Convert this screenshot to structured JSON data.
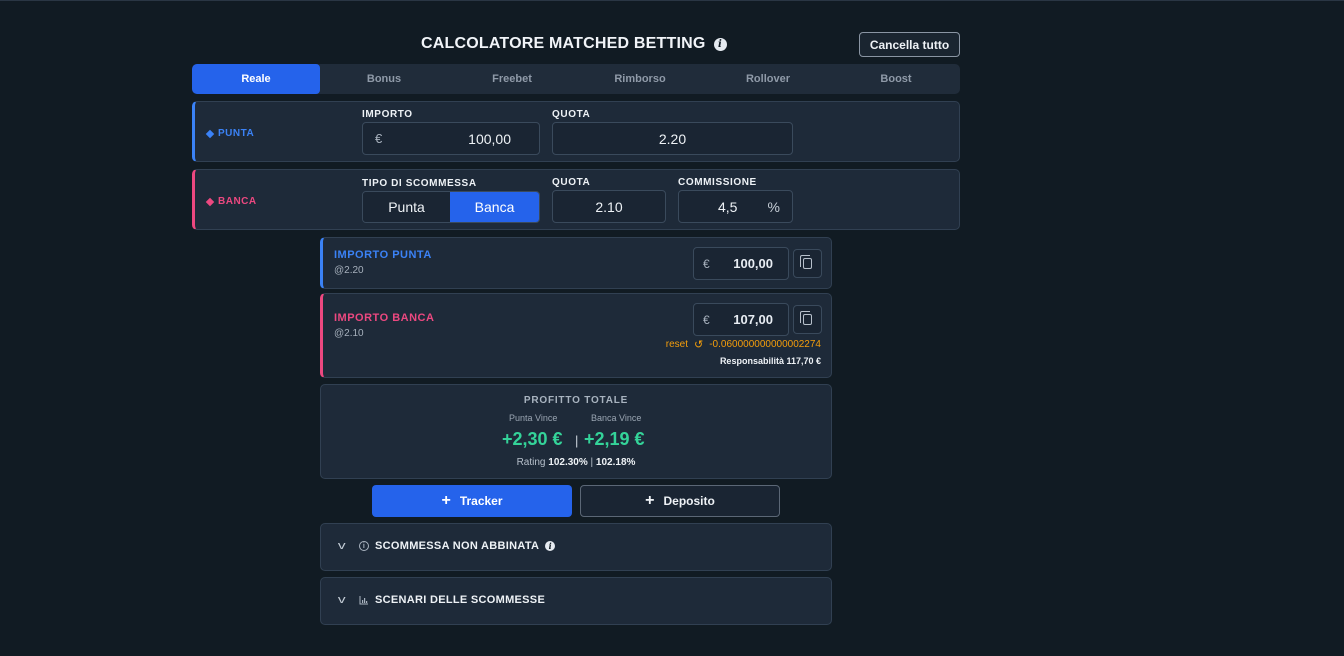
{
  "header": {
    "title": "CALCOLATORE MATCHED BETTING",
    "clear_button": "Cancella tutto"
  },
  "tabs": [
    {
      "label": "Reale",
      "active": true
    },
    {
      "label": "Bonus",
      "active": false
    },
    {
      "label": "Freebet",
      "active": false
    },
    {
      "label": "Rimborso",
      "active": false
    },
    {
      "label": "Rollover",
      "active": false
    },
    {
      "label": "Boost",
      "active": false
    }
  ],
  "punta": {
    "label": "PUNTA",
    "importo_label": "IMPORTO",
    "currency": "€",
    "importo_value": "100,00",
    "quota_label": "QUOTA",
    "quota_value": "2.20"
  },
  "banca": {
    "label": "BANCA",
    "tipo_label": "TIPO DI SCOMMESSA",
    "tipo_options": [
      "Punta",
      "Banca"
    ],
    "tipo_selected": "Banca",
    "quota_label": "QUOTA",
    "quota_value": "2.10",
    "commissione_label": "COMMISSIONE",
    "commissione_value": "4,5",
    "commissione_unit": "%"
  },
  "results": {
    "punta": {
      "title": "IMPORTO PUNTA",
      "odds": "@2.20",
      "currency": "€",
      "amount": "100,00"
    },
    "banca": {
      "title": "IMPORTO BANCA",
      "odds": "@2.10",
      "currency": "€",
      "amount": "107,00",
      "reset_label": "reset",
      "delta": "-0.060000000000002274",
      "liability": "Responsabilità 117,70 €"
    }
  },
  "profit": {
    "title": "PROFITTO TOTALE",
    "punta_label": "Punta Vince",
    "banca_label": "Banca Vince",
    "punta_value": "+2,30 €",
    "banca_value": "+2,19 €",
    "separator": "|",
    "rating_label": "Rating",
    "rating_punta": "102.30%",
    "rating_banca": "102.18%"
  },
  "actions": {
    "tracker": "Tracker",
    "deposito": "Deposito"
  },
  "accordions": [
    {
      "title": "SCOMMESSA NON ABBINATA"
    },
    {
      "title": "SCENARI DELLE SCOMMESSE"
    }
  ],
  "colors": {
    "accent_blue": "#2563eb",
    "punta_blue": "#3b82f6",
    "banca_pink": "#ec4880",
    "profit_green": "#34d399",
    "reset_orange": "#f59e0b"
  }
}
